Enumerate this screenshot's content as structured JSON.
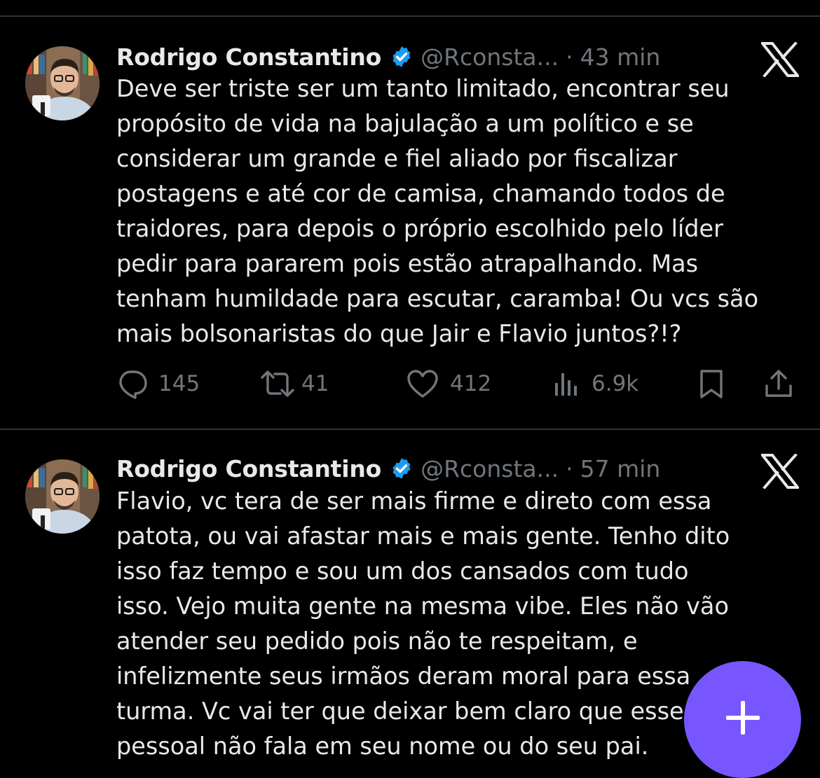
{
  "colors": {
    "background": "#000000",
    "text": "#e7e9ea",
    "secondary": "#71767b",
    "verified": "#1d9bf0",
    "fab": "#7856ff",
    "divider": "#2f3336"
  },
  "tweets": [
    {
      "author_name": "Rodrigo Constantino",
      "handle": "@Rconsta...",
      "separator": "·",
      "time": "43 min",
      "verified": true,
      "source_icon": "x-logo-icon",
      "lines": [
        "Deve ser triste ser um tanto limitado, encontrar seu",
        "propósito de vida na bajulação a um político e se",
        "considerar um grande e fiel aliado por fiscalizar",
        "postagens e até cor de camisa, chamando todos de",
        "traidores, para depois o próprio escolhido pelo líder",
        "pedir para pararem pois estão atrapalhando. Mas",
        "tenham humildade para escutar, caramba! Ou vcs são",
        "mais bolsonaristas do que Jair e Flavio juntos?!?"
      ],
      "actions": {
        "replies": "145",
        "retweets": "41",
        "likes": "412",
        "views": "6.9k"
      }
    },
    {
      "author_name": "Rodrigo Constantino",
      "handle": "@Rconsta...",
      "separator": "·",
      "time": "57 min",
      "verified": true,
      "source_icon": "x-logo-icon",
      "lines": [
        "Flavio, vc tera de ser mais firme e direto com essa",
        "patota, ou vai afastar mais e mais gente. Tenho dito",
        "isso faz tempo e sou um dos cansados com tudo",
        "isso. Vejo muita gente na mesma vibe. Eles não vão",
        "atender seu pedido pois não te respeitam, e",
        "infelizmente seus irmãos deram moral para essa",
        "turma. Vc vai ter que deixar bem claro que esse",
        "pessoal não fala em seu nome ou do seu pai."
      ]
    }
  ],
  "fab": {
    "icon": "plus-icon"
  }
}
